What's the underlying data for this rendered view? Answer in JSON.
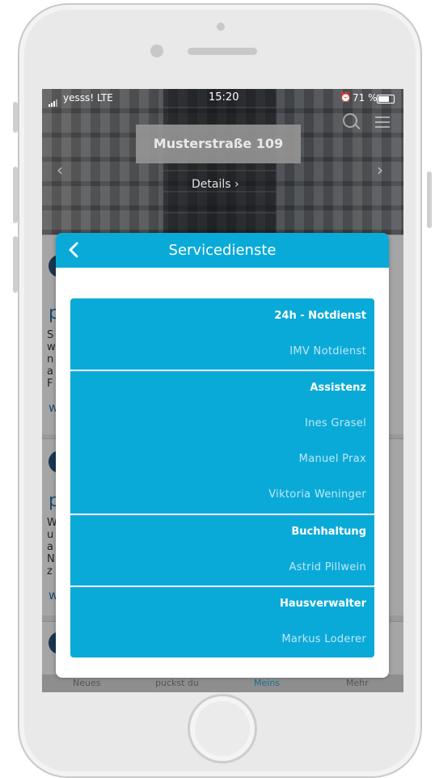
{
  "status_bar": {
    "carrier": "yesss!  LTE",
    "time": "15:20",
    "battery": "71 %"
  },
  "hero": {
    "title": "Musterstraße 109",
    "details_label": "Details"
  },
  "feed": {
    "card1": {
      "title": "p",
      "lines": [
        "S",
        "w",
        "n",
        "a",
        "F"
      ],
      "link": "w"
    },
    "card2": {
      "title": "p",
      "lines": [
        "W",
        "u",
        "a",
        "N",
        "z"
      ],
      "link": "w"
    }
  },
  "tabbar": {
    "items": [
      "Neues",
      "puckst du",
      "Meins",
      "Mehr"
    ]
  },
  "modal": {
    "title": "Servicedienste",
    "sections": [
      {
        "heading": "24h - Notdienst",
        "entries": [
          "IMV Notdienst"
        ]
      },
      {
        "heading": "Assistenz",
        "entries": [
          "Ines Grasel",
          "Manuel Prax",
          "Viktoria Weninger"
        ]
      },
      {
        "heading": "Buchhaltung",
        "entries": [
          "Astrid Pillwein"
        ]
      },
      {
        "heading": "Hausverwalter",
        "entries": [
          "Markus Loderer"
        ]
      }
    ]
  },
  "colors": {
    "accent": "#0aaad8",
    "entry_text": "#bfe8f6"
  },
  "icons": {
    "back": "chevron-left-icon",
    "search": "search-icon",
    "menu": "menu-icon"
  }
}
